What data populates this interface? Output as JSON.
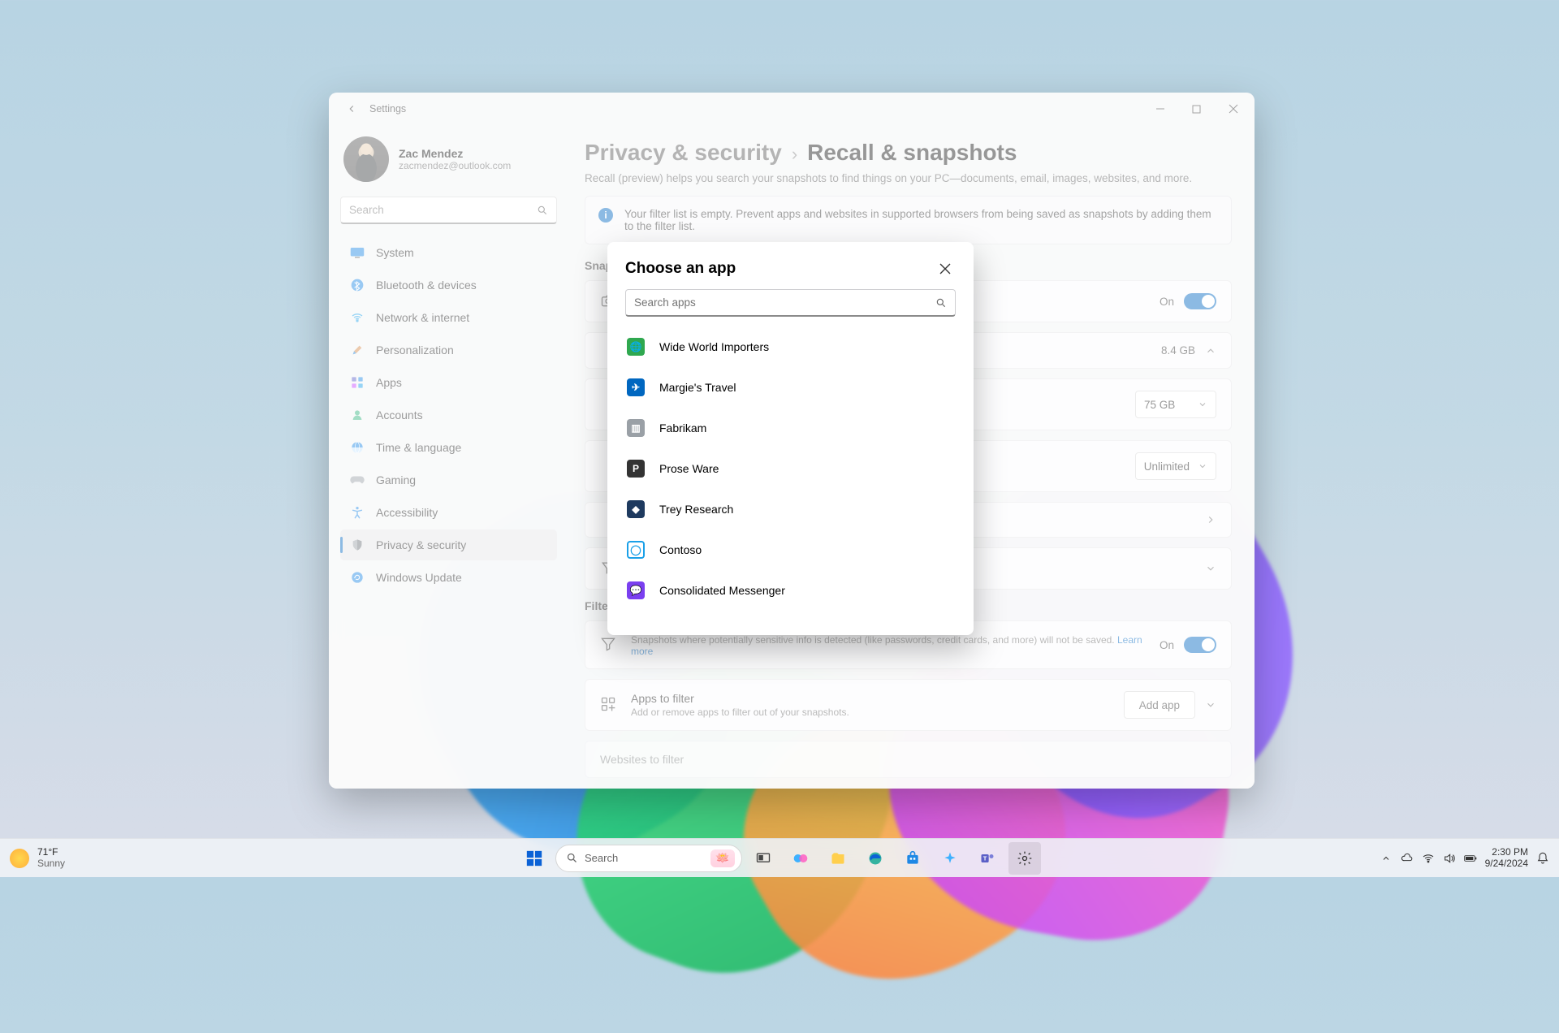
{
  "window": {
    "title": "Settings",
    "user": {
      "name": "Zac Mendez",
      "email": "zacmendez@outlook.com"
    },
    "search_placeholder": "Search",
    "nav": [
      {
        "key": "system",
        "label": "System"
      },
      {
        "key": "bluetooth",
        "label": "Bluetooth & devices"
      },
      {
        "key": "network",
        "label": "Network & internet"
      },
      {
        "key": "personalization",
        "label": "Personalization"
      },
      {
        "key": "apps",
        "label": "Apps"
      },
      {
        "key": "accounts",
        "label": "Accounts"
      },
      {
        "key": "time",
        "label": "Time & language"
      },
      {
        "key": "gaming",
        "label": "Gaming"
      },
      {
        "key": "accessibility",
        "label": "Accessibility"
      },
      {
        "key": "privacy",
        "label": "Privacy & security",
        "selected": true
      },
      {
        "key": "update",
        "label": "Windows Update"
      }
    ]
  },
  "content": {
    "breadcrumb_parent": "Privacy & security",
    "breadcrumb_current": "Recall & snapshots",
    "description": "Recall (preview) helps you search your snapshots to find things on your PC—documents, email, images, websites, and more.",
    "info_banner": "Your filter list is empty. Prevent apps and websites in supported browsers from being saved as snapshots by adding them to the filter list.",
    "section_snapshots": "Snapshots",
    "card_save": {
      "toggle_label": "On"
    },
    "card_storage": {
      "value": "8.4 GB"
    },
    "card_limit": {
      "value": "75 GB"
    },
    "card_duration": {
      "value": "Unlimited"
    },
    "section_filter": "Filter",
    "card_sensitive": {
      "sub": "Snapshots where potentially sensitive info is detected (like passwords, credit cards, and more) will not be saved. ",
      "link": "Learn more",
      "toggle_label": "On"
    },
    "card_apps_filter": {
      "title": "Apps to filter",
      "sub": "Add or remove apps to filter out of your snapshots.",
      "button": "Add app"
    },
    "card_websites": {
      "title": "Websites to filter"
    }
  },
  "dialog": {
    "title": "Choose an app",
    "search_placeholder": "Search apps",
    "apps": [
      {
        "name": "Wide World Importers",
        "color": "#2fa84f",
        "glyph": "🌐"
      },
      {
        "name": "Margie's Travel",
        "color": "#0067c0",
        "glyph": "✈"
      },
      {
        "name": "Fabrikam",
        "color": "#9aa0a6",
        "glyph": "▥"
      },
      {
        "name": "Prose Ware",
        "color": "#333333",
        "glyph": "P"
      },
      {
        "name": "Trey Research",
        "color": "#1e3a5f",
        "glyph": "◆"
      },
      {
        "name": "Contoso",
        "color": "#ffffff",
        "glyph": "◯",
        "fg": "#1aa0e8",
        "ring": true
      },
      {
        "name": "Consolidated Messenger",
        "color": "#7a3ff0",
        "glyph": "💬"
      }
    ]
  },
  "taskbar": {
    "weather_temp": "71°F",
    "weather_cond": "Sunny",
    "search_placeholder": "Search",
    "time": "2:30 PM",
    "date": "9/24/2024"
  }
}
